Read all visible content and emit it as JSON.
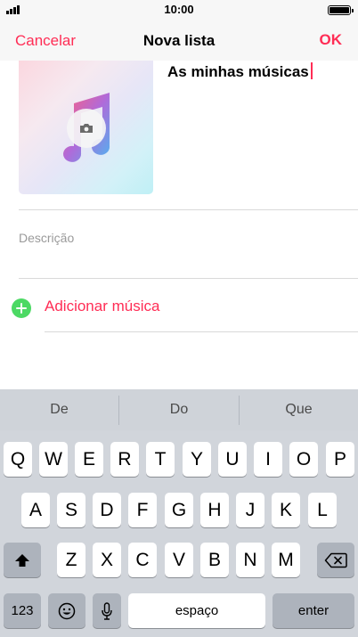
{
  "status_bar": {
    "time": "10:00",
    "battery_level": 1.0
  },
  "nav": {
    "cancel_label": "Cancelar",
    "title": "Nova lista",
    "ok_label": "OK"
  },
  "playlist": {
    "name": "As minhas músicas",
    "description_placeholder": "Descrição"
  },
  "add_music": {
    "label": "Adicionar música"
  },
  "keyboard": {
    "suggestions": [
      "De",
      "Do",
      "Que"
    ],
    "row1": [
      "Q",
      "W",
      "E",
      "R",
      "T",
      "Y",
      "U",
      "I",
      "O",
      "P"
    ],
    "row2": [
      "A",
      "S",
      "D",
      "F",
      "G",
      "H",
      "J",
      "K",
      "L"
    ],
    "row3": [
      "Z",
      "X",
      "C",
      "V",
      "B",
      "N",
      "M"
    ],
    "numbers_label": "123",
    "space_label": "espaço",
    "enter_label": "enter"
  },
  "colors": {
    "accent": "#ff2d55",
    "add_green": "#4cd964",
    "keyboard_bg": "#d1d5db"
  }
}
